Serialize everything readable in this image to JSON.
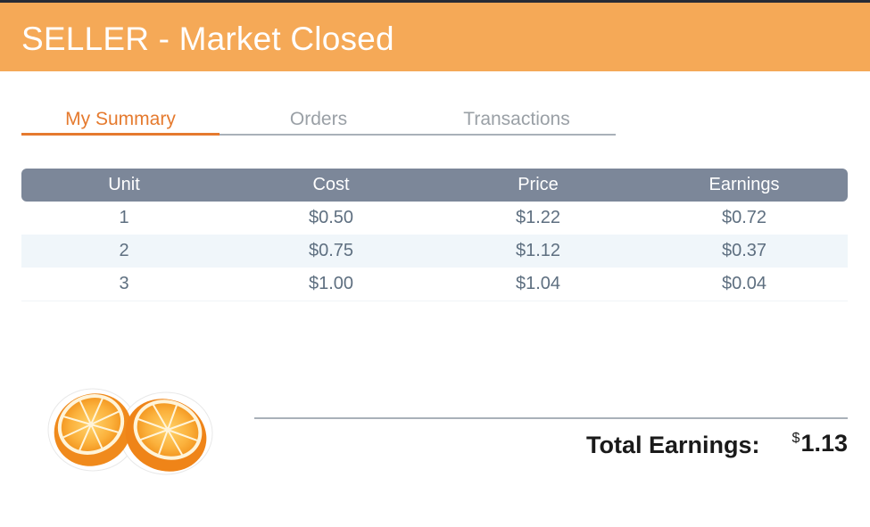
{
  "header": {
    "title": "SELLER - Market Closed",
    "color": "#f5a957"
  },
  "tabs": [
    {
      "label": "My Summary",
      "active": true
    },
    {
      "label": "Orders",
      "active": false
    },
    {
      "label": "Transactions",
      "active": false
    }
  ],
  "table": {
    "columns": [
      "Unit",
      "Cost",
      "Price",
      "Earnings"
    ],
    "rows": [
      [
        "1",
        "$0.50",
        "$1.22",
        "$0.72"
      ],
      [
        "2",
        "$0.75",
        "$1.12",
        "$0.37"
      ],
      [
        "3",
        "$1.00",
        "$1.04",
        "$0.04"
      ]
    ]
  },
  "total": {
    "label": "Total Earnings:",
    "currency": "$",
    "value": "1.13"
  },
  "illustration": {
    "icon": "orange-halves-icon"
  },
  "colors": {
    "accent": "#e57a2e",
    "table_header": "#7c8799",
    "row_alt": "#f0f6fa",
    "text_muted": "#5e6f80"
  }
}
